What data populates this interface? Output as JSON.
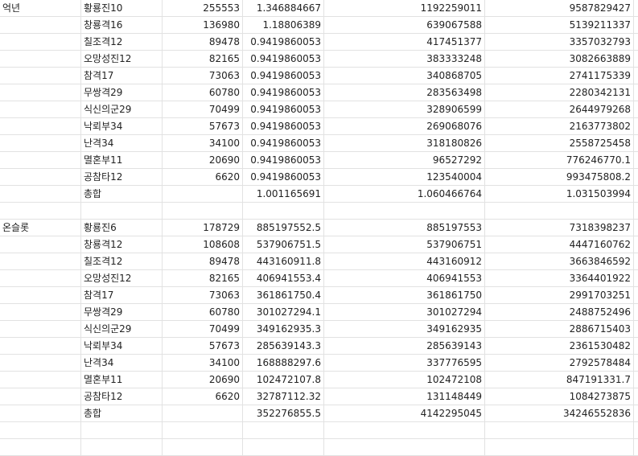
{
  "sections": [
    {
      "group": "억년",
      "rows": [
        {
          "name": "황룡진10",
          "a": "255553",
          "b": "1.346884667",
          "c": "1192259011",
          "d": "9587829427"
        },
        {
          "name": "창룡격16",
          "a": "136980",
          "b": "1.18806389",
          "c": "639067588",
          "d": "5139211337"
        },
        {
          "name": "칠조격12",
          "a": "89478",
          "b": "0.9419860053",
          "c": "417451377",
          "d": "3357032793"
        },
        {
          "name": "오망성진12",
          "a": "82165",
          "b": "0.9419860053",
          "c": "383333248",
          "d": "3082663889"
        },
        {
          "name": "참격17",
          "a": "73063",
          "b": "0.9419860053",
          "c": "340868705",
          "d": "2741175339"
        },
        {
          "name": "무쌍격29",
          "a": "60780",
          "b": "0.9419860053",
          "c": "283563498",
          "d": "2280342131"
        },
        {
          "name": "식신의군29",
          "a": "70499",
          "b": "0.9419860053",
          "c": "328906599",
          "d": "2644979268"
        },
        {
          "name": "낙뢰부34",
          "a": "57673",
          "b": "0.9419860053",
          "c": "269068076",
          "d": "2163773802"
        },
        {
          "name": "난격34",
          "a": "34100",
          "b": "0.9419860053",
          "c": "318180826",
          "d": "2558725458"
        },
        {
          "name": "멸혼부11",
          "a": "20690",
          "b": "0.9419860053",
          "c": "96527292",
          "d": "776246770.1"
        },
        {
          "name": "공참타12",
          "a": "6620",
          "b": "0.9419860053",
          "c": "123540004",
          "d": "993475808.2"
        },
        {
          "name": "총합",
          "a": "",
          "b": "1.001165691",
          "c": "1.060466764",
          "d": "1.031503994"
        }
      ]
    },
    {
      "group": "온슬롯",
      "rows": [
        {
          "name": "황룡진6",
          "a": "178729",
          "b": "885197552.5",
          "c": "885197553",
          "d": "7318398237"
        },
        {
          "name": "창룡격12",
          "a": "108608",
          "b": "537906751.5",
          "c": "537906751",
          "d": "4447160762"
        },
        {
          "name": "칠조격12",
          "a": "89478",
          "b": "443160911.8",
          "c": "443160912",
          "d": "3663846592"
        },
        {
          "name": "오망성진12",
          "a": "82165",
          "b": "406941553.4",
          "c": "406941553",
          "d": "3364401922"
        },
        {
          "name": "참격17",
          "a": "73063",
          "b": "361861750.4",
          "c": "361861750",
          "d": "2991703251"
        },
        {
          "name": "무쌍격29",
          "a": "60780",
          "b": "301027294.1",
          "c": "301027294",
          "d": "2488752496"
        },
        {
          "name": "식신의군29",
          "a": "70499",
          "b": "349162935.3",
          "c": "349162935",
          "d": "2886715403"
        },
        {
          "name": "낙뢰부34",
          "a": "57673",
          "b": "285639143.3",
          "c": "285639143",
          "d": "2361530482"
        },
        {
          "name": "난격34",
          "a": "34100",
          "b": "168888297.6",
          "c": "337776595",
          "d": "2792578484"
        },
        {
          "name": "멸혼부11",
          "a": "20690",
          "b": "102472107.8",
          "c": "102472108",
          "d": "847191331.7"
        },
        {
          "name": "공참타12",
          "a": "6620",
          "b": "32787112.32",
          "c": "131148449",
          "d": "1084273875"
        },
        {
          "name": "총합",
          "a": "",
          "b": "352276855.5",
          "c": "4142295045",
          "d": "34246552836"
        }
      ]
    }
  ]
}
